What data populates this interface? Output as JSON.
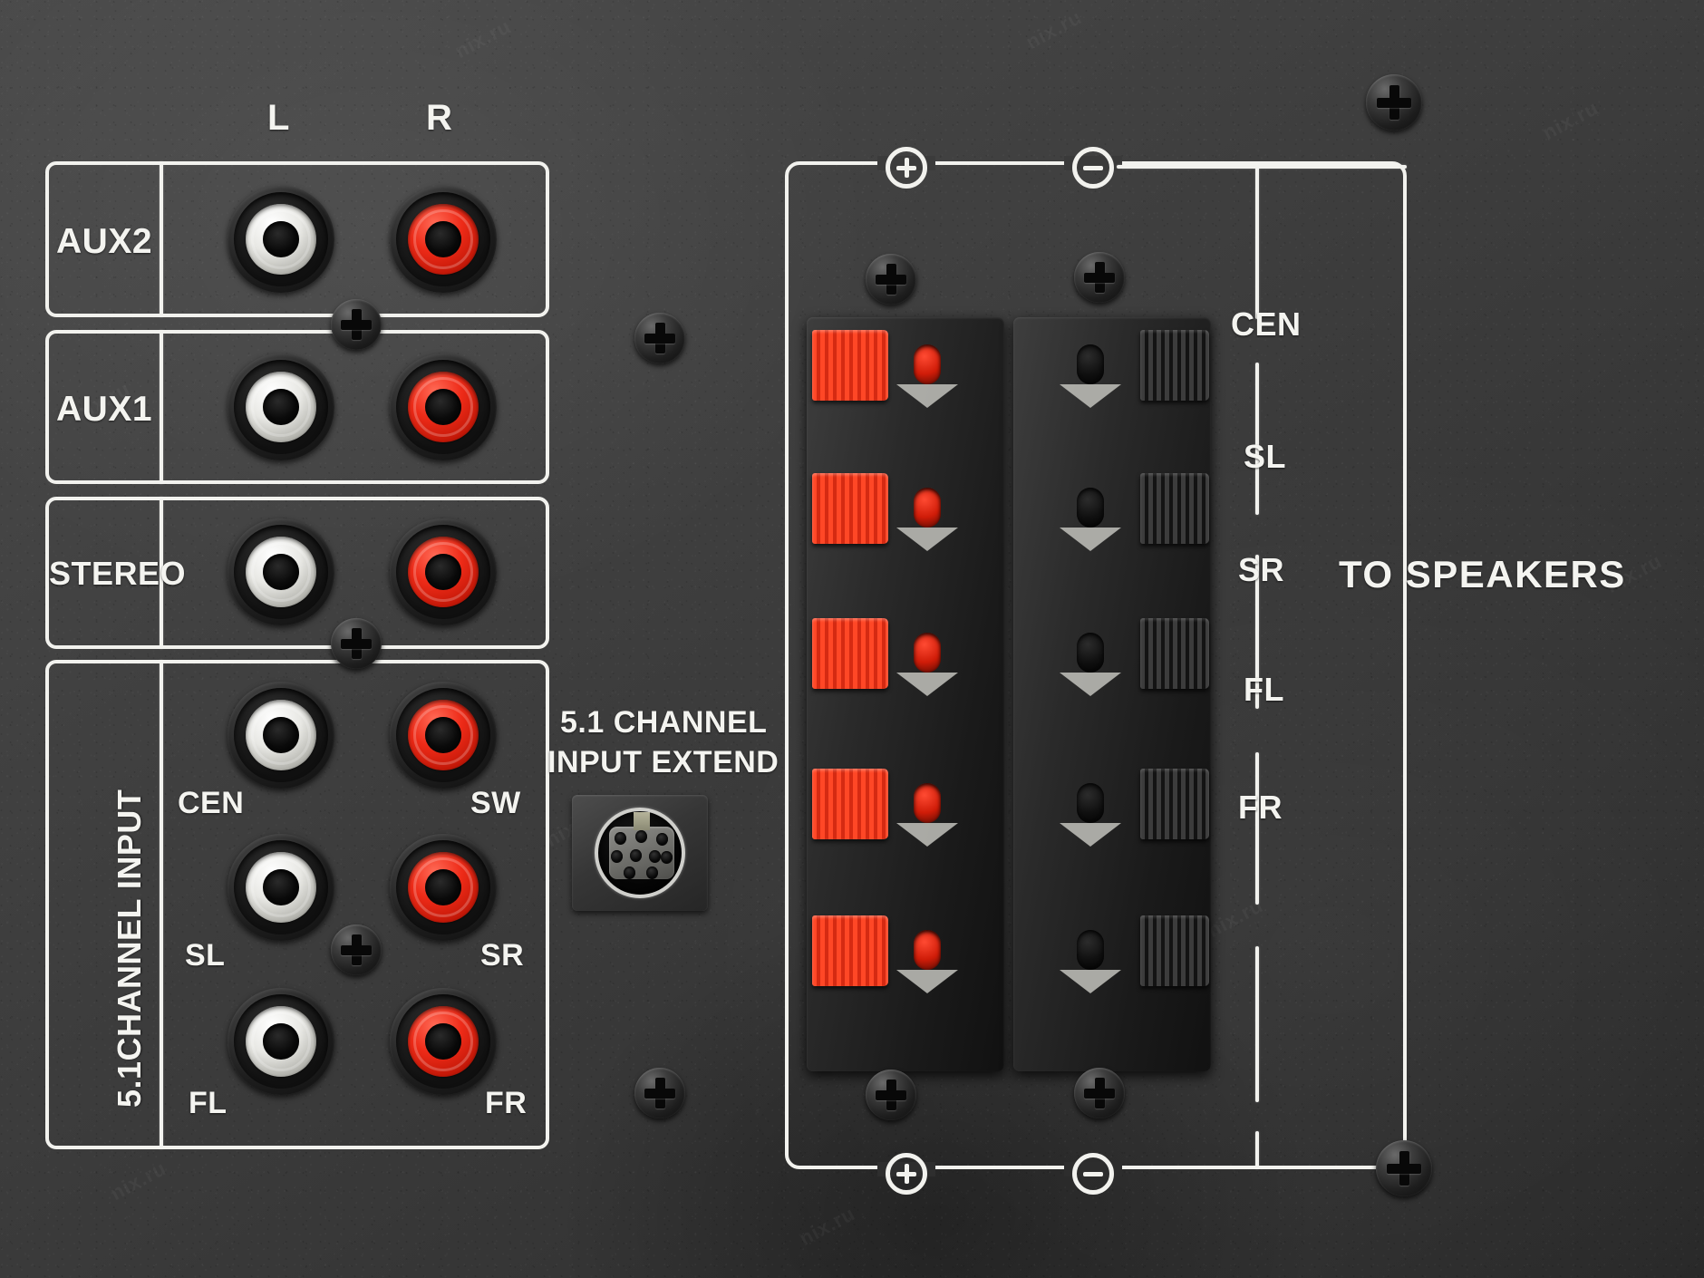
{
  "device": {
    "panel_type": "audio-amplifier-rear-panel",
    "background_color": "#3a3a3a",
    "silkscreen_color": "#f2f2ee",
    "accent_red": "#ee2b18"
  },
  "input_section": {
    "column_headers": {
      "left": "L",
      "right": "R"
    },
    "rows": [
      {
        "label": "AUX2",
        "jacks": [
          {
            "channel": "L",
            "color": "white"
          },
          {
            "channel": "R",
            "color": "red"
          }
        ]
      },
      {
        "label": "AUX1",
        "jacks": [
          {
            "channel": "L",
            "color": "white"
          },
          {
            "channel": "R",
            "color": "red"
          }
        ]
      },
      {
        "label": "STEREO",
        "jacks": [
          {
            "channel": "L",
            "color": "white"
          },
          {
            "channel": "R",
            "color": "red"
          }
        ]
      }
    ],
    "multichannel": {
      "label": "5.1CHANNEL INPUT",
      "jack_labels": [
        {
          "left": "CEN",
          "right": "SW"
        },
        {
          "left": "SL",
          "right": "SR"
        },
        {
          "left": "FL",
          "right": "FR"
        }
      ],
      "jack_colors": [
        {
          "left": "white",
          "right": "red"
        },
        {
          "left": "white",
          "right": "red"
        },
        {
          "left": "white",
          "right": "red"
        }
      ]
    }
  },
  "extend_port": {
    "title_line1": "5.1 CHANNEL",
    "title_line2": "INPUT  EXTEND",
    "connector_type": "mini-din-9-pin",
    "pin_count": 9
  },
  "speaker_section": {
    "title": "TO SPEAKERS",
    "polarity": {
      "positive": "+",
      "negative": "−"
    },
    "channels": [
      "CEN",
      "SL",
      "SR",
      "FL",
      "FR"
    ],
    "terminal_rows": 5,
    "positive_lever_color": "#ee2b18",
    "negative_lever_color": "#1a1a1a"
  },
  "watermarks": [
    "nix.ru",
    "nix.ru",
    "nix.ru",
    "nix.ru",
    "nix.ru",
    "nix.ru",
    "nix.ru",
    "nix.ru",
    "nix.ru",
    "nix.ru"
  ]
}
